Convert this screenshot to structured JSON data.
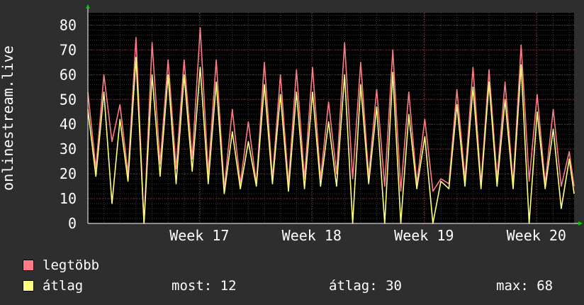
{
  "chart_data": {
    "type": "line",
    "ylabel": "onlinestream.live",
    "ylim": [
      0,
      85
    ],
    "yticks": [
      0,
      10,
      20,
      30,
      40,
      50,
      60,
      70,
      80
    ],
    "grid": true,
    "x_ticks": [
      "Week 17",
      "Week 18",
      "Week 19",
      "Week 20"
    ],
    "x_tick_days": [
      6.95,
      13.95,
      20.95,
      27.95
    ],
    "x_range_days": [
      0,
      30.3
    ],
    "series": [
      {
        "name": "legtöbb",
        "color": "#ff7c86",
        "x": [
          0,
          0.5,
          1,
          1.5,
          2,
          2.5,
          3,
          3.5,
          4,
          4.5,
          5,
          5.5,
          6,
          6.5,
          7,
          7.5,
          8,
          8.5,
          9,
          9.5,
          10,
          10.5,
          11,
          11.5,
          12,
          12.5,
          13,
          13.5,
          14,
          14.5,
          15,
          15.5,
          16,
          16.5,
          17,
          17.5,
          18,
          18.5,
          19,
          19.5,
          20,
          20.5,
          21,
          21.5,
          22,
          22.5,
          23,
          23.5,
          24,
          24.5,
          25,
          25.5,
          26,
          26.5,
          27,
          27.5,
          28,
          28.5,
          29,
          29.5,
          30,
          30.3
        ],
        "values": [
          53,
          22,
          60,
          33,
          48,
          20,
          75,
          0,
          73,
          24,
          66,
          22,
          66,
          26,
          79,
          20,
          66,
          14,
          46,
          16,
          41,
          16,
          65,
          18,
          60,
          16,
          62,
          18,
          63,
          18,
          49,
          20,
          73,
          18,
          65,
          19,
          54,
          15,
          70,
          13,
          53,
          16,
          42,
          13,
          18,
          16,
          54,
          18,
          63,
          16,
          62,
          18,
          57,
          16,
          72,
          17,
          52,
          16,
          46,
          15,
          29,
          15
        ]
      },
      {
        "name": "átlag",
        "color": "#ffff80",
        "x": [
          0,
          0.5,
          1,
          1.5,
          2,
          2.5,
          3,
          3.5,
          4,
          4.5,
          5,
          5.5,
          6,
          6.5,
          7,
          7.5,
          8,
          8.5,
          9,
          9.5,
          10,
          10.5,
          11,
          11.5,
          12,
          12.5,
          13,
          13.5,
          14,
          14.5,
          15,
          15.5,
          16,
          16.5,
          17,
          17.5,
          18,
          18.5,
          19,
          19.5,
          20,
          20.5,
          21,
          21.5,
          22,
          22.5,
          23,
          23.5,
          24,
          24.5,
          25,
          25.5,
          26,
          26.5,
          27,
          27.5,
          28,
          28.5,
          29,
          29.5,
          30,
          30.3
        ],
        "values": [
          46,
          19,
          53,
          8,
          42,
          17,
          67,
          0,
          60,
          19,
          60,
          16,
          60,
          21,
          63,
          16,
          57,
          12,
          37,
          14,
          33,
          15,
          56,
          16,
          52,
          13,
          53,
          14,
          53,
          15,
          41,
          15,
          60,
          0,
          56,
          16,
          47,
          0,
          61,
          0,
          44,
          14,
          35,
          0,
          17,
          14,
          48,
          15,
          55,
          14,
          57,
          15,
          50,
          14,
          64,
          0,
          45,
          14,
          38,
          6,
          26,
          12
        ]
      }
    ],
    "stats": {
      "most_label": "most:",
      "most_value": "12",
      "avg_label": "átlag:",
      "avg_value": "30",
      "max_label": "max:",
      "max_value": "68"
    },
    "colors": {
      "background": "#2e2e2e",
      "canvas": "#000000",
      "grid_major": "#6b2b2b",
      "grid_minor": "#3a3a3a",
      "axis_arrow": "#00cc00"
    }
  }
}
